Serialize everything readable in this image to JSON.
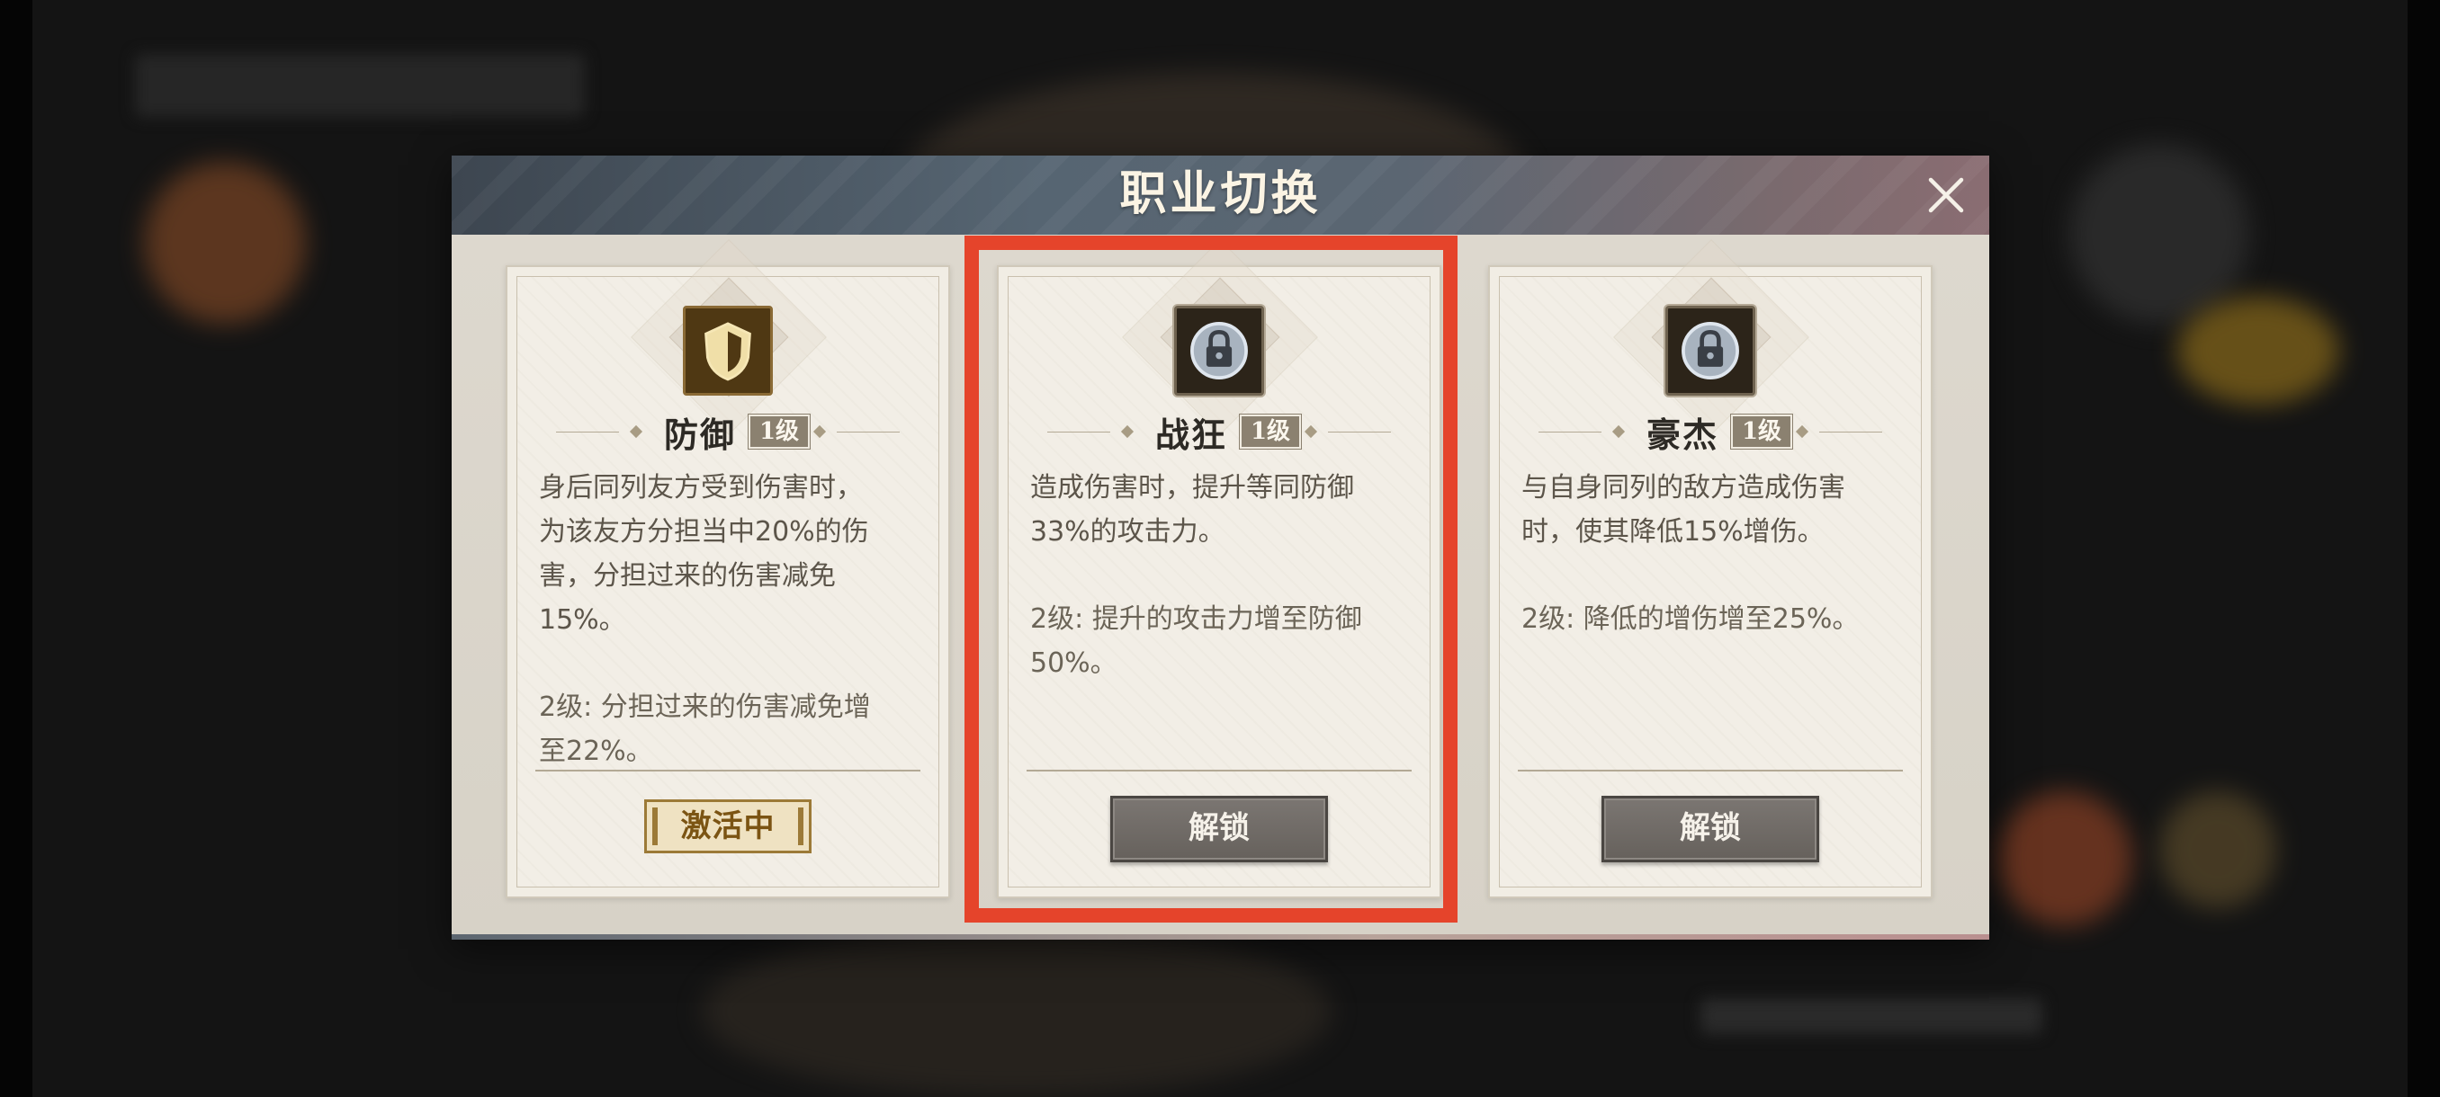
{
  "dialog": {
    "title": "职业切换"
  },
  "cards": [
    {
      "name": "防御",
      "level": "1级",
      "icon": "shield-icon",
      "description": "身后同列友方受到伤害时，\n为该友方分担当中20%的伤\n害，分担过来的伤害减免\n15%。",
      "level2": "2级: 分担过来的伤害减免增\n至22%。",
      "status": "激活中"
    },
    {
      "name": "战狂",
      "level": "1级",
      "icon": "lock-icon",
      "description": "造成伤害时，提升等同防御\n33%的攻击力。",
      "level2": "2级: 提升的攻击力增至防御\n50%。",
      "action": "解锁"
    },
    {
      "name": "豪杰",
      "level": "1级",
      "icon": "lock-icon",
      "description": "与自身同列的敌方造成伤害\n时，使其降低15%增伤。",
      "level2": "2级: 降低的增伤增至25%。",
      "action": "解锁"
    }
  ],
  "colors": {
    "highlight": "#e5442b",
    "active_gold": "#9c7a37",
    "level_badge": "#8b8170"
  }
}
